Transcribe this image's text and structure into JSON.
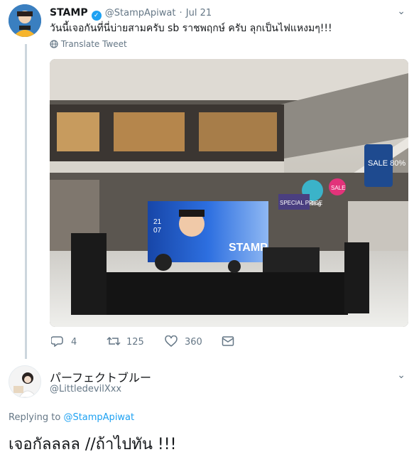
{
  "tweet": {
    "author_name": "STAMP",
    "author_handle": "@StampApiwat",
    "separator": "·",
    "date": "Jul 21",
    "text": "วันนี้เจอกันที่นี่บ่ายสามครับ sb ราชพฤกษ์ ครับ ลุกเป็นไฟแหงมๆ!!!",
    "translate_label": "Translate Tweet",
    "actions": {
      "reply_count": "4",
      "retweet_count": "125",
      "like_count": "360"
    },
    "photo": {
      "screen_texts": [
        "STAMP",
        "21",
        "07"
      ],
      "signs": [
        "SALE",
        "Best Selling",
        "SPECIAL PRICE",
        "SALE 80%"
      ]
    }
  },
  "reply": {
    "author_name": "パーフェクトブルー",
    "author_handle": "@LittledevilXxx",
    "replying_prefix": "Replying to",
    "replying_to": "@StampApiwat",
    "text": "เจอกัลลลล //ถ้าไปทัน !!!"
  },
  "colors": {
    "link": "#1da1f2",
    "secondary_text": "#657786",
    "thread_line": "#ccd6dd"
  },
  "icons": [
    "chevron-down-icon",
    "verified-icon",
    "globe-icon",
    "reply-icon",
    "retweet-icon",
    "like-icon",
    "dm-icon"
  ]
}
